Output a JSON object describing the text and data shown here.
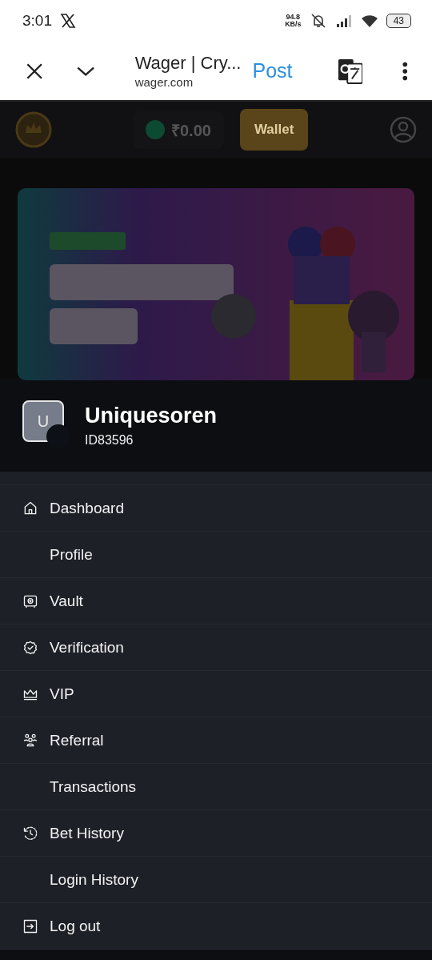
{
  "status_bar": {
    "time": "3:01",
    "net_speed": "94.8",
    "net_unit": "KB/s",
    "battery": "43"
  },
  "browser_bar": {
    "title": "Wager | Cry...",
    "url": "wager.com",
    "action": "Post"
  },
  "page_behind": {
    "balance": "₹0.00",
    "wallet_button": "Wallet"
  },
  "profile": {
    "avatar_letter": "U",
    "username": "Uniquesoren",
    "user_id": "ID83596"
  },
  "menu": [
    {
      "label": "Dashboard",
      "kind": "home"
    },
    {
      "label": "Profile",
      "kind": "plain"
    },
    {
      "label": "Vault",
      "kind": "safe"
    },
    {
      "label": "Verification",
      "kind": "badge"
    },
    {
      "label": "VIP",
      "kind": "crown"
    },
    {
      "label": "Referral",
      "kind": "people"
    },
    {
      "label": "Transactions",
      "kind": "plain"
    },
    {
      "label": "Bet History",
      "kind": "history"
    },
    {
      "label": "Login History",
      "kind": "plain"
    },
    {
      "label": "Log out",
      "kind": "logout"
    }
  ]
}
